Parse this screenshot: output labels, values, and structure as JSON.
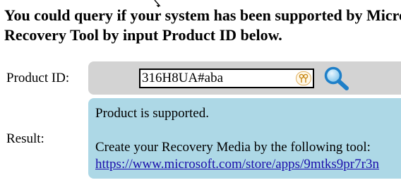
{
  "header": {
    "line1": "You could query if your system has been supported by Microsoft",
    "line2": "Recovery Tool by input Product ID below."
  },
  "form": {
    "product_id_label": "Product ID:",
    "product_id_value": "316H8UA#aba",
    "search_icon": "magnifier-icon",
    "key_icon": "password-manager-key-icon",
    "result_label": "Result:"
  },
  "result": {
    "status": "Product is supported.",
    "instruction": "Create your Recovery Media by the following tool:",
    "link_text": "https://www.microsoft.com/store/apps/9mtks9pr7r3n"
  },
  "colors": {
    "input_bar_bg": "#d3d3d3",
    "result_bg": "#add8e6",
    "link": "#1a0dab"
  }
}
